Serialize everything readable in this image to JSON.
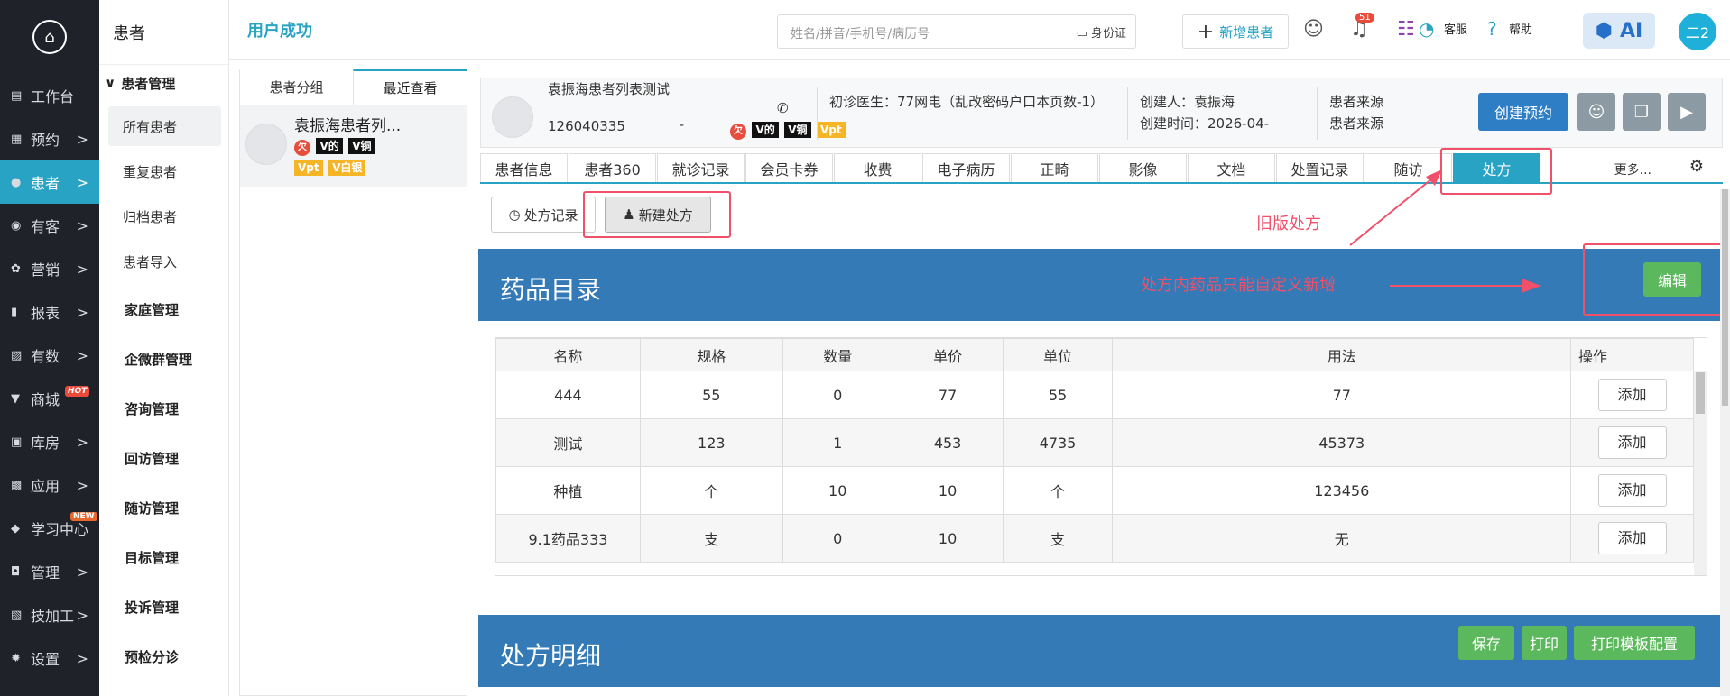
{
  "leftnav": {
    "items": [
      {
        "icon": "workbench-icon",
        "glyph": "▤",
        "label": "工作台",
        "chev": ""
      },
      {
        "icon": "appointment-icon",
        "glyph": "▦",
        "label": "预约",
        "chev": ">"
      },
      {
        "icon": "patient-icon",
        "glyph": "●",
        "label": "患者",
        "chev": ">"
      },
      {
        "icon": "youke-icon",
        "glyph": "◉",
        "label": "有客",
        "chev": ">"
      },
      {
        "icon": "marketing-icon",
        "glyph": "✿",
        "label": "营销",
        "chev": ">"
      },
      {
        "icon": "report-icon",
        "glyph": "▮",
        "label": "报表",
        "chev": ">"
      },
      {
        "icon": "data-icon",
        "glyph": "▨",
        "label": "有数",
        "chev": ">"
      },
      {
        "icon": "mall-icon",
        "glyph": "▼",
        "label": "商城",
        "chev": ""
      },
      {
        "icon": "warehouse-icon",
        "glyph": "▣",
        "label": "库房",
        "chev": ">"
      },
      {
        "icon": "apps-icon",
        "glyph": "▩",
        "label": "应用",
        "chev": ">"
      },
      {
        "icon": "learning-icon",
        "glyph": "◆",
        "label": "学习中心",
        "chev": ""
      },
      {
        "icon": "manage-icon",
        "glyph": "◘",
        "label": "管理",
        "chev": ">"
      },
      {
        "icon": "technician-icon",
        "glyph": "▧",
        "label": "技加工",
        "chev": ">"
      },
      {
        "icon": "settings-icon",
        "glyph": "✹",
        "label": "设置",
        "chev": ">"
      }
    ],
    "hot_badge": "HOT",
    "new_badge": "NEW"
  },
  "subnav": {
    "title": "患者",
    "group": "患者管理",
    "items": [
      "所有患者",
      "重复患者",
      "归档患者",
      "患者导入"
    ],
    "sections": [
      "家庭管理",
      "企微群管理",
      "咨询管理",
      "回访管理",
      "随访管理",
      "目标管理",
      "投诉管理",
      "预检分诊"
    ]
  },
  "topbar": {
    "title": "用户成功",
    "search_placeholder": "姓名/拼音/手机号/病历号",
    "idcard": "身份证",
    "add_patient": "新增患者",
    "bell_count": "51",
    "kefu": "客服",
    "help": "帮助",
    "ai": "AI",
    "user": "二2"
  },
  "plist": {
    "tabs": [
      "患者分组",
      "最近查看"
    ],
    "card": {
      "name": "袁振海患者列...",
      "tags": [
        "V的",
        "V铜",
        "Vpt",
        "V白银"
      ],
      "owe": "欠"
    }
  },
  "pinfo": {
    "name": "袁振海患者列表测试",
    "pid": "126040335",
    "dash": "-",
    "phone_icon": "✆",
    "tags": [
      "V的",
      "V铜",
      "Vpt"
    ],
    "owe": "欠",
    "doctor": "初诊医生：77网电（乱改密码户口本页数-1）",
    "creator": "创建人：袁振海",
    "created_time": "创建时间：2026-04-",
    "source1": "患者来源",
    "source2": "患者来源",
    "create_appt": "创建预约"
  },
  "tabs": [
    "患者信息",
    "患者360",
    "就诊记录",
    "会员卡券",
    "收费",
    "电子病历",
    "正畸",
    "影像",
    "文档",
    "处置记录",
    "随访",
    "处方"
  ],
  "tab_more": "更多...",
  "buttons": {
    "history": "处方记录",
    "new": "新建处方"
  },
  "annotations": {
    "old": "旧版处方",
    "custom": "处方内药品只能自定义新增"
  },
  "catalog": {
    "title": "药品目录",
    "edit": "编辑",
    "headers": [
      "名称",
      "规格",
      "数量",
      "单价",
      "单位",
      "用法",
      "操作"
    ],
    "rows": [
      [
        "444",
        "55",
        "0",
        "77",
        "55",
        "77",
        "添加"
      ],
      [
        "测试",
        "123",
        "1",
        "453",
        "4735",
        "45373",
        "添加"
      ],
      [
        "种植",
        "个",
        "10",
        "10",
        "个",
        "123456",
        "添加"
      ],
      [
        "9.1药品333",
        "支",
        "0",
        "10",
        "支",
        "无",
        "添加"
      ]
    ]
  },
  "detail": {
    "title": "处方明细",
    "save": "保存",
    "print": "打印",
    "print_tpl": "打印模板配置"
  }
}
